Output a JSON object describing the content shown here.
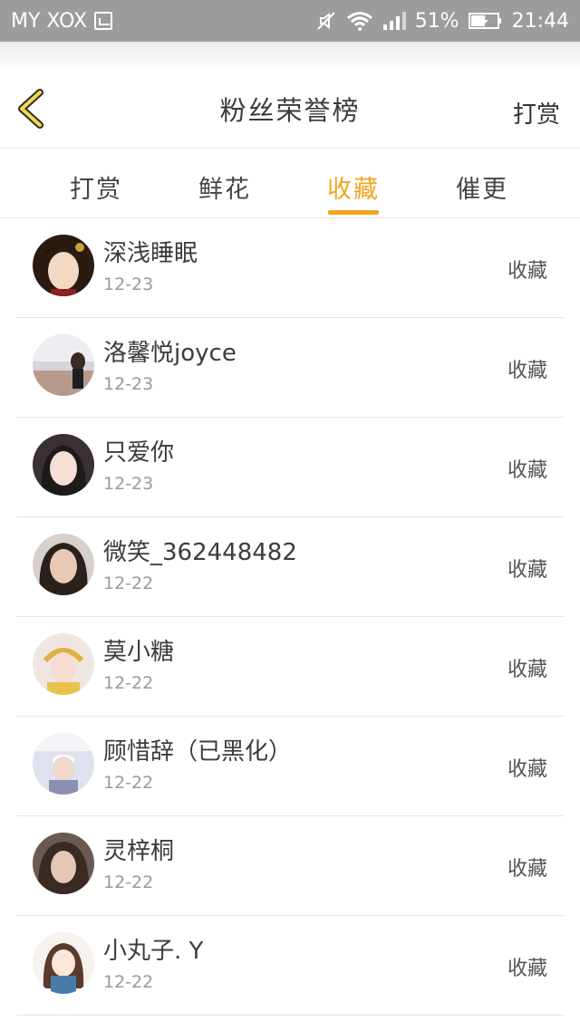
{
  "status_bar": {
    "carrier": "MY XOX",
    "battery": "51%",
    "time": "21:44",
    "icons": [
      "sim-card-icon",
      "mute-icon",
      "wifi-icon",
      "signal-icon",
      "battery-charging-icon"
    ]
  },
  "header": {
    "back_icon": "chevron-left-icon",
    "title": "粉丝荣誉榜",
    "right_label": "打赏"
  },
  "tabs": [
    {
      "label": "打赏",
      "active": false
    },
    {
      "label": "鲜花",
      "active": false
    },
    {
      "label": "收藏",
      "active": true
    },
    {
      "label": "催更",
      "active": false
    }
  ],
  "colors": {
    "accent": "#f2a51f",
    "status_bar": "#9c9c9c",
    "text": "#3c3c3c",
    "muted": "#9a9a9a"
  },
  "fans": [
    {
      "name": "深浅睡眠",
      "date": "12-23",
      "action": "收藏"
    },
    {
      "name": "洛馨悦joyce",
      "date": "12-23",
      "action": "收藏"
    },
    {
      "name": "只爱你",
      "date": "12-23",
      "action": "收藏"
    },
    {
      "name": "微笑_362448482",
      "date": "12-22",
      "action": "收藏"
    },
    {
      "name": "莫小糖",
      "date": "12-22",
      "action": "收藏"
    },
    {
      "name": "顾惜辞（已黑化）",
      "date": "12-22",
      "action": "收藏"
    },
    {
      "name": "灵梓桐",
      "date": "12-22",
      "action": "收藏"
    },
    {
      "name": "小丸子. Y",
      "date": "12-22",
      "action": "收藏"
    }
  ]
}
